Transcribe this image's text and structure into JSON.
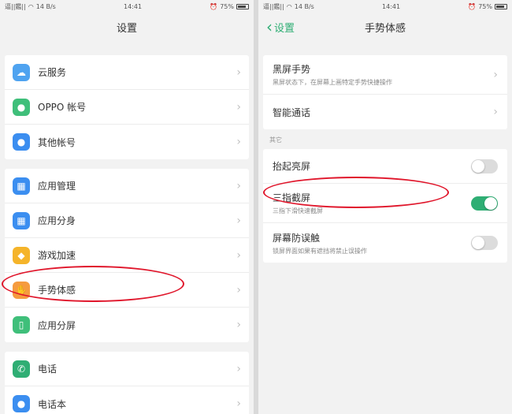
{
  "left_screen": {
    "status": {
      "carrier": "逼||鑑||",
      "speed": "14 B/s",
      "time": "14:41",
      "battery": "75%"
    },
    "title": "设置",
    "groups": [
      [
        {
          "label": "云服务",
          "icon": "cloud-icon",
          "color": "#4fa3f0",
          "glyph": "☁"
        },
        {
          "label": "OPPO 帐号",
          "icon": "user-icon",
          "color": "#3fbf7a",
          "glyph": "●"
        },
        {
          "label": "其他帐号",
          "icon": "person-icon",
          "color": "#3b8ef0",
          "glyph": "●"
        }
      ],
      [
        {
          "label": "应用管理",
          "icon": "apps-grid-icon",
          "color": "#3b8ef0",
          "glyph": "▦"
        },
        {
          "label": "应用分身",
          "icon": "app-clone-icon",
          "color": "#3b8ef0",
          "glyph": "▦"
        },
        {
          "label": "游戏加速",
          "icon": "game-icon",
          "color": "#f5b42a",
          "glyph": "◆"
        },
        {
          "label": "手势体感",
          "icon": "hand-gesture-icon",
          "color": "#f59b3f",
          "glyph": "✋"
        },
        {
          "label": "应用分屏",
          "icon": "split-screen-icon",
          "color": "#3fbf7a",
          "glyph": "▯"
        }
      ],
      [
        {
          "label": "电话",
          "icon": "phone-icon",
          "color": "#2fae74",
          "glyph": "✆"
        },
        {
          "label": "电话本",
          "icon": "contacts-icon",
          "color": "#3b8ef0",
          "glyph": "●"
        }
      ]
    ]
  },
  "right_screen": {
    "status": {
      "carrier": "逼||鑑||",
      "speed": "14 B/s",
      "time": "14:41",
      "battery": "75%"
    },
    "back_label": "设置",
    "title": "手势体感",
    "group1": [
      {
        "title": "黑屏手势",
        "subtitle": "黑屏状态下，在屏幕上画特定手势快捷操作"
      },
      {
        "title": "智能通话",
        "subtitle": ""
      }
    ],
    "section_label": "其它",
    "group2": [
      {
        "title": "抬起亮屏",
        "subtitle": "",
        "on": false
      },
      {
        "title": "三指截屏",
        "subtitle": "三指下滑快速截屏",
        "on": true
      },
      {
        "title": "屏幕防误触",
        "subtitle": "锁屏界面如果有遮挡将禁止误操作",
        "on": false
      }
    ]
  },
  "colors": {
    "accent": "#2fae74",
    "annotation": "#e0162b"
  }
}
